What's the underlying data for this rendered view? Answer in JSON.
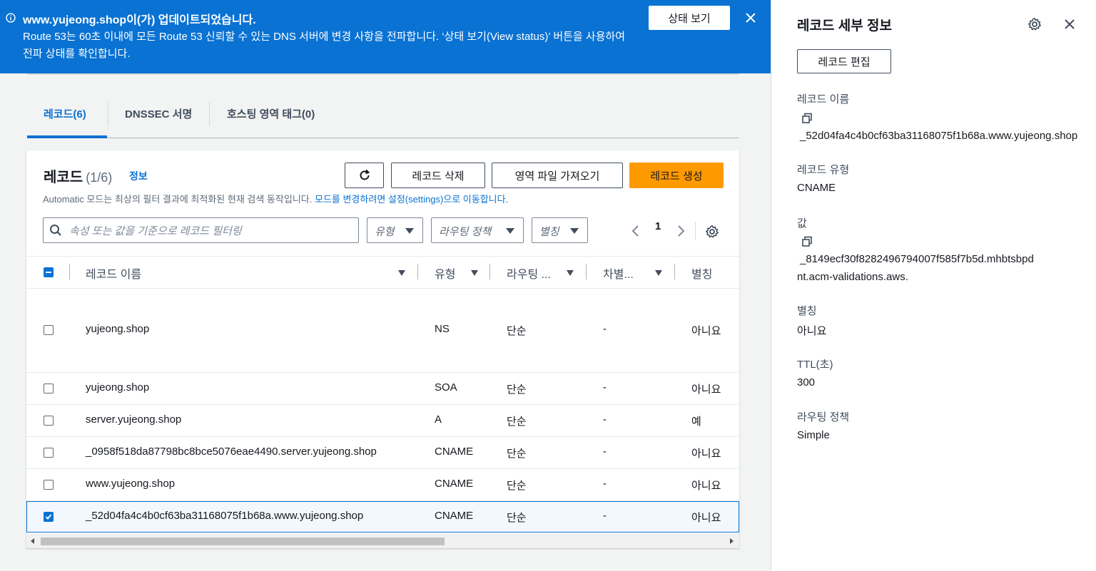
{
  "banner": {
    "title": "www.yujeong.shop이(가) 업데이트되었습니다.",
    "body": "Route 53는 60초 이내에 모든 Route 53 신뢰할 수 있는 DNS 서버에 변경 사항을 전파합니다. ‘상태 보기(View status)’ 버튼을 사용하여 전파 상태를 확인합니다.",
    "status_button": "상태 보기",
    "icons": {
      "info": "info-icon",
      "close": "close-icon"
    },
    "color": "#0972d3"
  },
  "tabs": [
    {
      "label": "레코드(6)",
      "active": true
    },
    {
      "label": "DNSSEC 서명",
      "active": false
    },
    {
      "label": "호스팅 영역 태그(0)",
      "active": false
    }
  ],
  "records_panel": {
    "title": "레코드",
    "count": "(1/6)",
    "info_link": "정보",
    "description": "Automatic 모드는 최상의 필터 결과에 최적화된 현재 검색 동작입니다.",
    "description_link": "모드를 변경하려면 설정(settings)으로 이동합니다.",
    "buttons": {
      "refresh_icon": "refresh-icon",
      "delete": "레코드 삭제",
      "import": "영역 파일 가져오기",
      "create": "레코드 생성"
    },
    "filter_placeholder": "속성 또는 값을 기준으로 레코드 필터링",
    "dropdowns": {
      "type": "유형",
      "routing": "라우팅 정책",
      "alias": "별칭"
    },
    "page": "1",
    "columns": [
      "레코드 이름",
      "유형",
      "라우팅 ...",
      "차별...",
      "별칭"
    ],
    "rows": [
      {
        "name": "yujeong.shop",
        "type": "NS",
        "routing": "단순",
        "diff": "-",
        "alias": "아니요",
        "checked": false
      },
      {
        "name": "yujeong.shop",
        "type": "SOA",
        "routing": "단순",
        "diff": "-",
        "alias": "아니요",
        "checked": false
      },
      {
        "name": "server.yujeong.shop",
        "type": "A",
        "routing": "단순",
        "diff": "-",
        "alias": "예",
        "checked": false
      },
      {
        "name": "_0958f518da87798bc8bce5076eae4490.server.yujeong.shop",
        "type": "CNAME",
        "routing": "단순",
        "diff": "-",
        "alias": "아니요",
        "checked": false
      },
      {
        "name": "www.yujeong.shop",
        "type": "CNAME",
        "routing": "단순",
        "diff": "-",
        "alias": "아니요",
        "checked": false
      },
      {
        "name": "_52d04fa4c4b0cf63ba31168075f1b68a.www.yujeong.shop",
        "type": "CNAME",
        "routing": "단순",
        "diff": "-",
        "alias": "아니요",
        "checked": true
      }
    ],
    "accent": "#ff9900"
  },
  "drawer": {
    "title": "레코드 세부 정보",
    "edit_button": "레코드 편집",
    "record_name_label": "레코드 이름",
    "record_name_value": "_52d04fa4c4b0cf63ba31168075f1b68a.www.yujeong.shop",
    "record_type_label": "레코드 유형",
    "record_type_value": "CNAME",
    "value_label": "값",
    "value_line1": "_8149ecf30f8282496794007f585f7b5d.mhbtsbpd",
    "value_line2": "nt.acm-validations.aws.",
    "alias_label": "별칭",
    "alias_value": "아니요",
    "ttl_label": "TTL(초)",
    "ttl_value": "300",
    "routing_label": "라우팅 정책",
    "routing_value": "Simple"
  }
}
